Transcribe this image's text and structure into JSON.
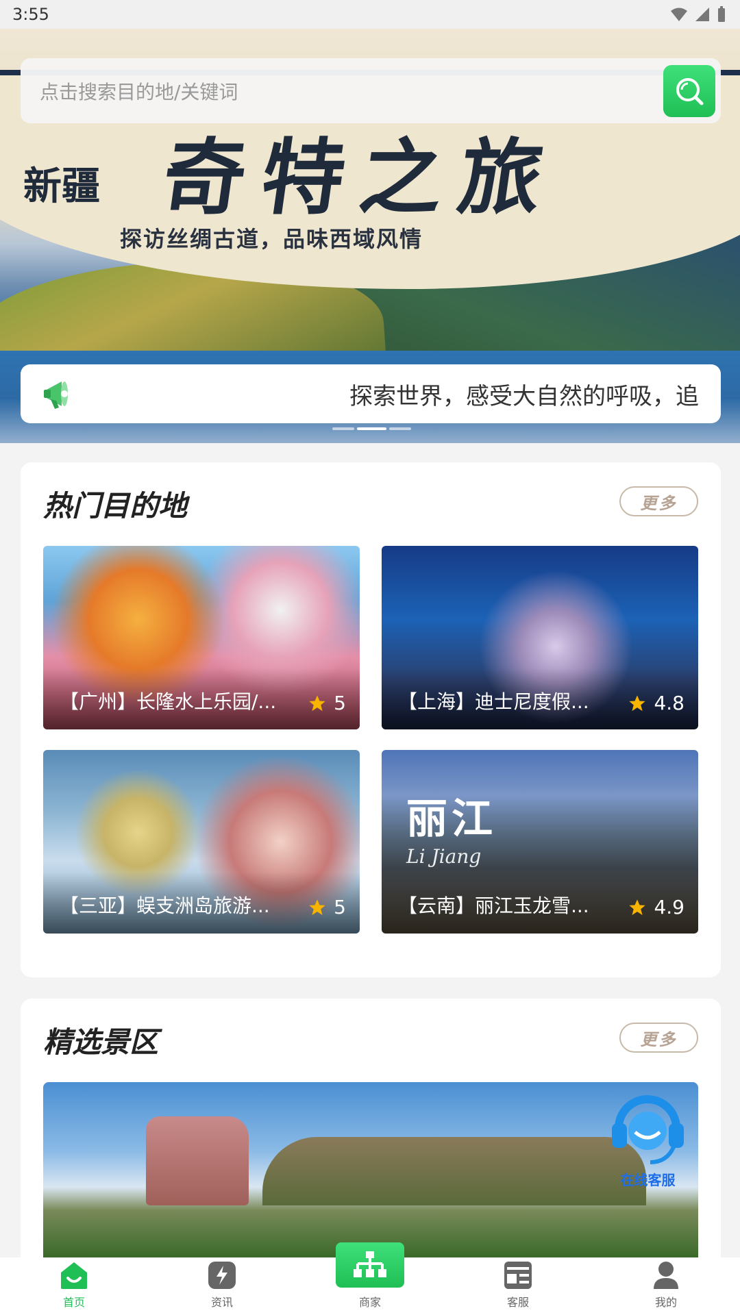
{
  "status_bar": {
    "time": "3:55"
  },
  "hero": {
    "region_text": "新疆",
    "title_text": "奇特之旅",
    "subtitle_text": "探访丝绸古道，品味西域风情"
  },
  "search": {
    "placeholder": "点击搜索目的地/关键词"
  },
  "notice": {
    "text": "探索世界，感受大自然的呼吸，追"
  },
  "hot_destinations": {
    "title": "热门目的地",
    "more_label": "更多",
    "items": [
      {
        "name": "【广州】长隆水上乐园/...",
        "rating": "5"
      },
      {
        "name": "【上海】迪士尼度假...",
        "rating": "4.8"
      },
      {
        "name": "【三亚】蜈支洲岛旅游...",
        "rating": "5"
      },
      {
        "name": "【云南】丽江玉龙雪...",
        "rating": "4.9"
      }
    ],
    "lijiang_overlay": {
      "cn": "丽江",
      "en": "Li Jiang"
    }
  },
  "scenic_spots": {
    "title": "精选景区",
    "more_label": "更多"
  },
  "floating_service": {
    "label": "在线客服"
  },
  "bottom_nav": {
    "items": [
      {
        "label": "首页",
        "icon": "home-icon",
        "active": true
      },
      {
        "label": "资讯",
        "icon": "news-icon",
        "active": false
      },
      {
        "label": "商家",
        "icon": "merchant-icon",
        "active": false
      },
      {
        "label": "客服",
        "icon": "service-icon",
        "active": false
      },
      {
        "label": "我的",
        "icon": "profile-icon",
        "active": false
      }
    ]
  },
  "colors": {
    "accent": "#1fbf55",
    "more_border": "#c8b8a8",
    "service_blue": "#1d6ee8"
  }
}
